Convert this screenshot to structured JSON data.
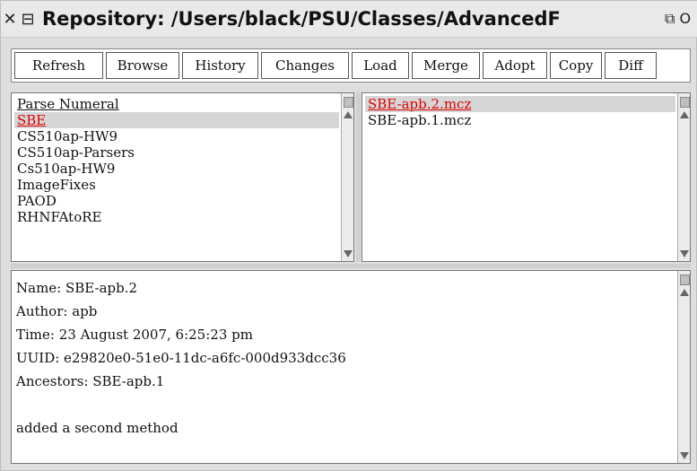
{
  "window": {
    "title": "Repository: /Users/black/PSU/Classes/AdvancedF",
    "close_glyph": "✕",
    "menu_glyph": "⊟",
    "right_glyph": "⧉ O"
  },
  "toolbar": {
    "buttons": [
      "Refresh",
      "Browse",
      "History",
      "Changes",
      "Load",
      "Merge",
      "Adopt",
      "Copy",
      "Diff"
    ]
  },
  "packages": {
    "items": [
      "Parse Numeral",
      "SBE",
      "CS510ap-HW9",
      "CS510ap-Parsers",
      "Cs510ap-HW9",
      "ImageFixes",
      "PAOD",
      "RHNFAtoRE"
    ],
    "selected_index": 1
  },
  "versions": {
    "items": [
      "SBE-apb.2.mcz",
      "SBE-apb.1.mcz"
    ],
    "selected_index": 0
  },
  "details": {
    "name": "Name: SBE-apb.2",
    "author": "Author: apb",
    "time": "Time: 23 August 2007, 6:25:23 pm",
    "uuid": "UUID: e29820e0-51e0-11dc-a6fc-000d933dcc36",
    "ancestors": "Ancestors: SBE-apb.1",
    "blank": "",
    "message": "added a second method"
  }
}
